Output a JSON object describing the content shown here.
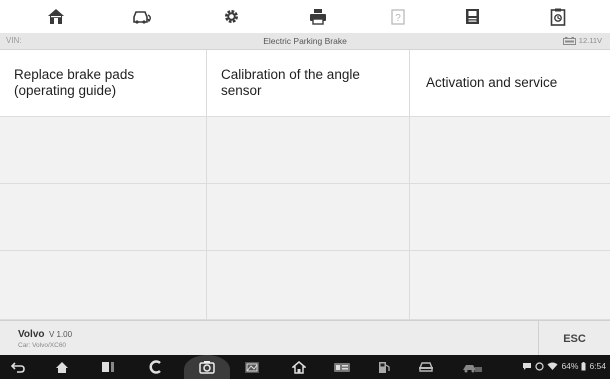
{
  "toolbar": {
    "buttons": [
      {
        "icon": "home-icon"
      },
      {
        "icon": "vehicle-swap-icon"
      },
      {
        "icon": "settings-gear-icon"
      },
      {
        "icon": "print-icon"
      },
      {
        "icon": "help-icon"
      },
      {
        "icon": "save-icon"
      },
      {
        "icon": "data-logging-icon"
      }
    ]
  },
  "infobar": {
    "vin_label": "VIN:",
    "title": "Electric Parking Brake",
    "voltage": "12.11V"
  },
  "functions": [
    "Replace brake pads (operating guide)",
    "Calibration of the angle sensor",
    "Activation and service"
  ],
  "footer": {
    "make": "Volvo",
    "version": "V 1.00",
    "car": "Car: Volvo/XC60",
    "esc_label": "ESC"
  },
  "statusbar": {
    "battery_percent": "64%",
    "time": "6:54"
  },
  "colors": {
    "toolbar_icon": "#3a3a3a",
    "infobar_bg": "#e6e6e6",
    "grid_bg": "#f2f2f2",
    "navbar_bg": "#141414"
  }
}
